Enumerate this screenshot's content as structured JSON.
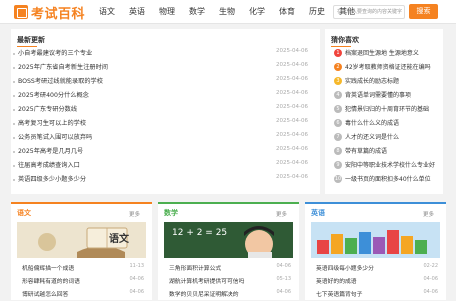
{
  "header": {
    "logo": "考试百科",
    "nav": [
      "语文",
      "英语",
      "物理",
      "数学",
      "生物",
      "化学",
      "体育",
      "历史",
      "其他"
    ],
    "search_placeholder": "在此输入要查询的内容关键字",
    "search_button": "搜索"
  },
  "latest": {
    "title": "最新更新",
    "items": [
      {
        "title": "小自考最建议考的三个专业",
        "date": "2025-04-06"
      },
      {
        "title": "2025年广东省自考新生注册时间",
        "date": "2025-04-06"
      },
      {
        "title": "BOSS考研过线就能录取的学校",
        "date": "2025-04-06"
      },
      {
        "title": "2025考研400分什么概念",
        "date": "2025-04-06"
      },
      {
        "title": "2025广东专研分数线",
        "date": "2025-04-06"
      },
      {
        "title": "高考复习生可以上的学校",
        "date": "2025-04-06"
      },
      {
        "title": "公务员笔试入围可以放弃吗",
        "date": "2025-04-06"
      },
      {
        "title": "2025年高考是几月几号",
        "date": "2025-04-06"
      },
      {
        "title": "往届高考成绩查询入口",
        "date": "2025-04-06"
      },
      {
        "title": "英语四级多少小题多少分",
        "date": "2025-04-06"
      }
    ]
  },
  "guess": {
    "title": "猜你喜欢",
    "items": [
      {
        "n": "1",
        "title": "档案退回生源地 生源地意义",
        "color": "#f0443c"
      },
      {
        "n": "2",
        "title": "42岁考取教师资格证还能在编吗",
        "color": "#f58220"
      },
      {
        "n": "3",
        "title": "实践成长的励志标题",
        "color": "#f6b82a"
      },
      {
        "n": "4",
        "title": "背英语单词需要懂的事项",
        "color": "#bbbbbb"
      },
      {
        "n": "5",
        "title": "犯情景归归的十周育环节的基础",
        "color": "#bbbbbb"
      },
      {
        "n": "6",
        "title": "毒什么什么义的成语",
        "color": "#bbbbbb"
      },
      {
        "n": "7",
        "title": "人才的还义词是什么",
        "color": "#bbbbbb"
      },
      {
        "n": "8",
        "title": "带有草篇的成语",
        "color": "#bbbbbb"
      },
      {
        "n": "9",
        "title": "安阳中等职业技术学校什么专业好",
        "color": "#bbbbbb"
      },
      {
        "n": "10",
        "title": "一级书页的面积扣多40什么单位",
        "color": "#bbbbbb"
      }
    ]
  },
  "bottom": [
    {
      "title": "语文",
      "more": "更多",
      "img_text": "语文",
      "items": [
        {
          "title": "机船偏辉描一个成语",
          "date": "11-13"
        },
        {
          "title": "形容肆耗有道的的词语",
          "date": "04-06"
        },
        {
          "title": "博研试越怎么回答",
          "date": "04-06"
        }
      ]
    },
    {
      "title": "数学",
      "more": "更多",
      "img_text": "12 + 2 = 25",
      "items": [
        {
          "title": "三角形面积计算公式",
          "date": "04-06"
        },
        {
          "title": "湖航计算机考研提供可可信吗",
          "date": "05-13"
        },
        {
          "title": "数学的贝贝尼采证明解决的",
          "date": "04-06"
        }
      ]
    },
    {
      "title": "英语",
      "more": "更多",
      "img_text": "",
      "items": [
        {
          "title": "英语四级每小题多少分",
          "date": "02-22"
        },
        {
          "title": "英语好的的成语",
          "date": "04-06"
        },
        {
          "title": "七下英语篇背句子",
          "date": "04-06"
        }
      ]
    }
  ],
  "colors": {
    "accent": "#f58220",
    "green": "#4caf50",
    "blue": "#3d8fd8"
  }
}
